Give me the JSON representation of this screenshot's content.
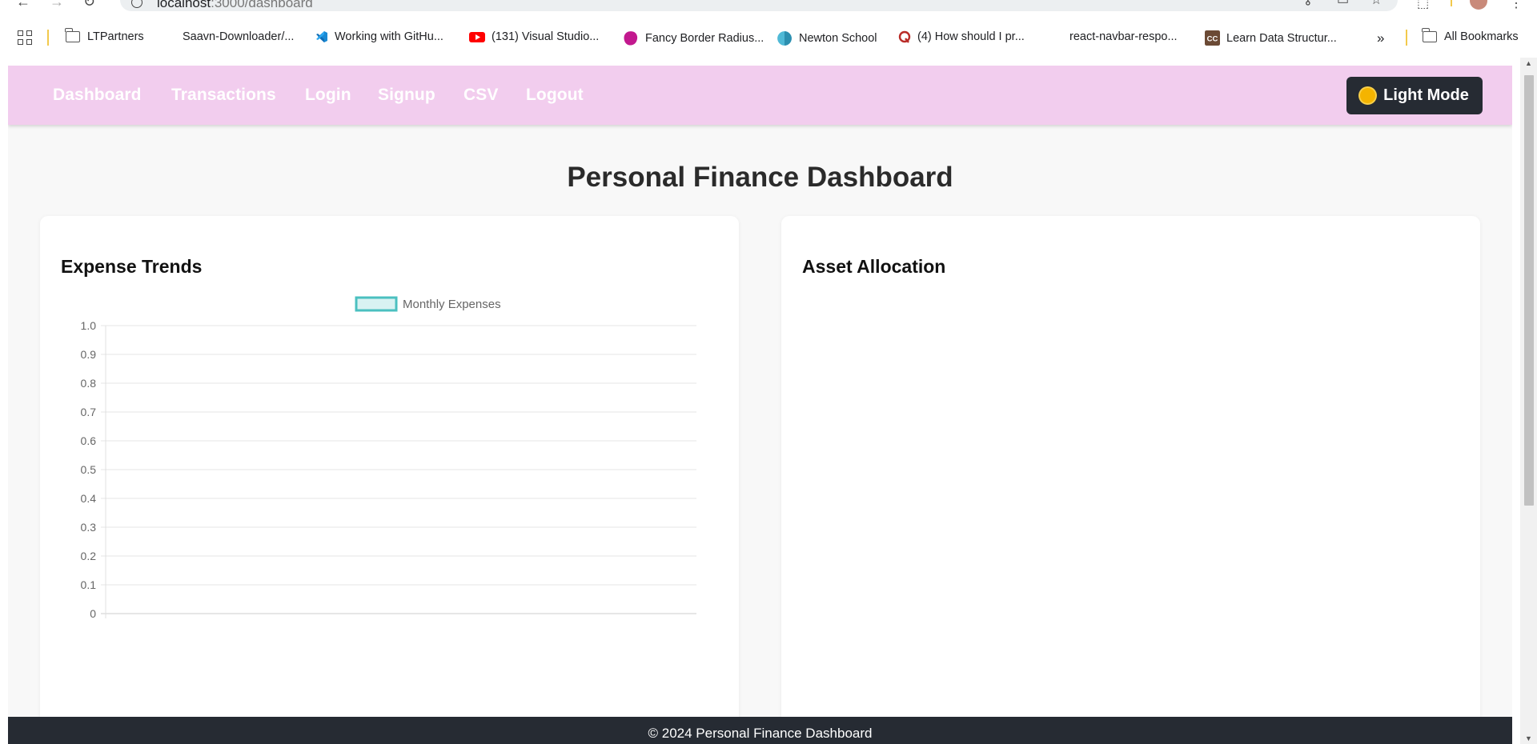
{
  "browser": {
    "url_host": "localhost",
    "url_path": ":3000/dashboard",
    "bookmarks": [
      {
        "label": "LTPartners",
        "icon": "folder-icon"
      },
      {
        "label": "Saavn-Downloader/...",
        "icon": "github-icon"
      },
      {
        "label": "Working with GitHu...",
        "icon": "vscode-icon"
      },
      {
        "label": "(131) Visual Studio...",
        "icon": "youtube-icon"
      },
      {
        "label": "Fancy Border Radius...",
        "icon": "blob-icon"
      },
      {
        "label": "Newton School",
        "icon": "newton-icon"
      },
      {
        "label": "(4) How should I pr...",
        "icon": "quora-icon"
      },
      {
        "label": "react-navbar-respo...",
        "icon": "github-icon"
      },
      {
        "label": "Learn Data Structur...",
        "icon": "codechef-icon"
      }
    ],
    "more_bookmarks": "»",
    "all_bookmarks": "All Bookmarks"
  },
  "navbar": {
    "links": [
      "Dashboard",
      "Transactions",
      "Login",
      "Signup",
      "CSV",
      "Logout"
    ],
    "mode_button": "Light Mode",
    "colors": {
      "bar": "#f2cdee",
      "link": "#ffffff",
      "button": "#262b33"
    }
  },
  "page": {
    "title": "Personal Finance Dashboard"
  },
  "cards": {
    "expense": {
      "title": "Expense Trends"
    },
    "assets": {
      "title": "Asset Allocation"
    }
  },
  "chart_data": {
    "type": "line",
    "x": [],
    "series": [
      {
        "name": "Monthly Expenses",
        "values": [],
        "color": "#4bc0c0"
      }
    ],
    "yticks": [
      "0",
      "0.1",
      "0.2",
      "0.3",
      "0.4",
      "0.5",
      "0.6",
      "0.7",
      "0.8",
      "0.9",
      "1.0"
    ],
    "ylim": [
      0,
      1
    ],
    "grid": true,
    "legend": "top"
  },
  "footer": {
    "text": "© 2024 Personal Finance Dashboard",
    "color": "#262b33"
  }
}
